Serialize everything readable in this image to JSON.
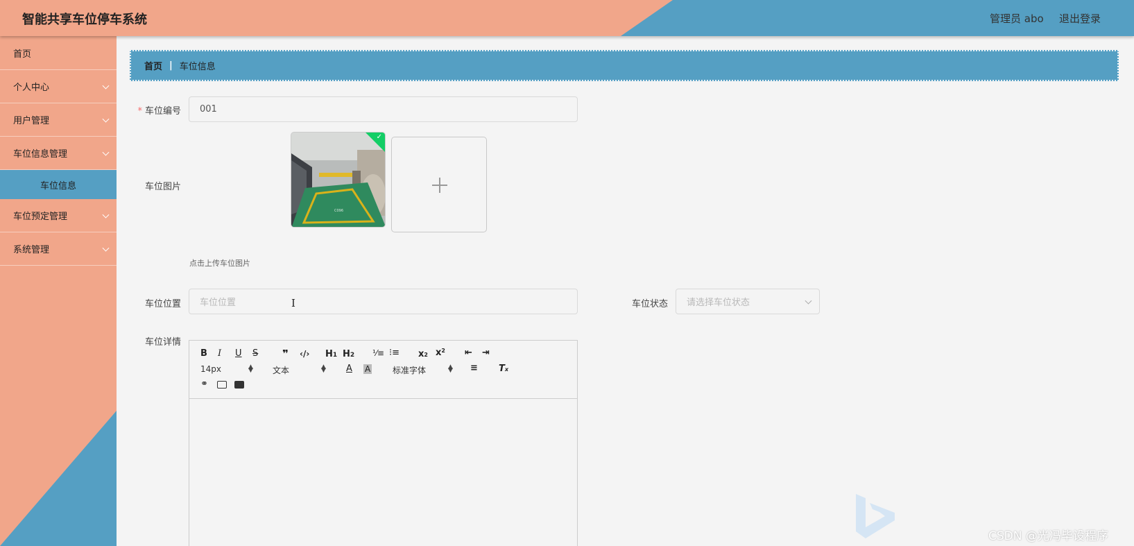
{
  "app": {
    "title": "智能共享车位停车系统",
    "user": "管理员 abo",
    "logout": "退出登录"
  },
  "sidebar": {
    "items": [
      {
        "label": "首页"
      },
      {
        "label": "个人中心"
      },
      {
        "label": "用户管理"
      },
      {
        "label": "车位信息管理"
      },
      {
        "label": "车位信息"
      },
      {
        "label": "车位预定管理"
      },
      {
        "label": "系统管理"
      }
    ]
  },
  "breadcrumb": {
    "home": "首页",
    "separator": "|",
    "current": "车位信息"
  },
  "form": {
    "number_label": "车位编号",
    "number_value": "001",
    "image_label": "车位图片",
    "upload_hint": "点击上传车位图片",
    "location_label": "车位位置",
    "location_placeholder": "车位位置",
    "status_label": "车位状态",
    "status_placeholder": "请选择车位状态",
    "detail_label": "车位详情"
  },
  "editor": {
    "font_size": "14px",
    "paragraph": "文本",
    "font_family": "标准字体"
  },
  "watermark": "CSDN @光冯毕设程序",
  "colors": {
    "salmon": "#f1a68a",
    "blue": "#559fc3",
    "success": "#13ce66"
  }
}
